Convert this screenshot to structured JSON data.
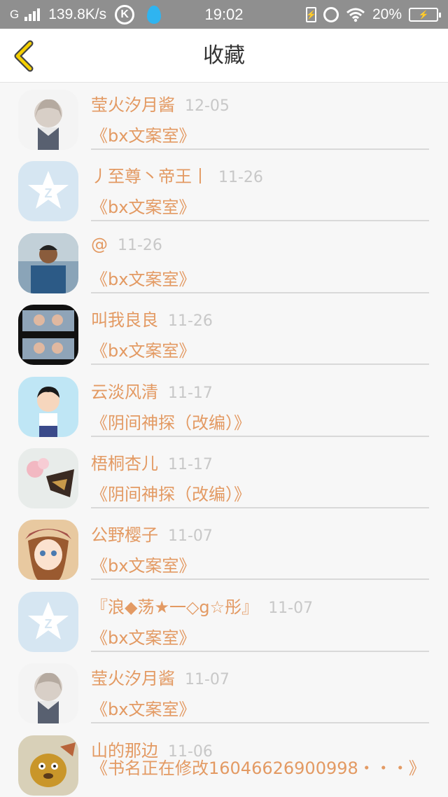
{
  "status_bar": {
    "network": "G",
    "speed": "139.8K/s",
    "k_label": "K",
    "time": "19:02",
    "battery": "20%"
  },
  "header": {
    "title": "收藏"
  },
  "favorites": [
    {
      "name": "莹火汐月酱",
      "date": "12-05",
      "title": "《bx文案室》",
      "avatar": "anime-girl-sketch"
    },
    {
      "name": "丿至尊丶帝王丨",
      "date": "11-26",
      "title": "《bx文案室》",
      "avatar": "qq-default-star"
    },
    {
      "name": "@",
      "date": "11-26",
      "title": "《bx文案室》",
      "avatar": "man-photo"
    },
    {
      "name": "叫我良良",
      "date": "11-26",
      "title": "《bx文案室》",
      "avatar": "film-strip-couple"
    },
    {
      "name": "云淡风清",
      "date": "11-17",
      "title": "《阴间神探（改编）》",
      "avatar": "cartoon-boy"
    },
    {
      "name": "梧桐杏儿",
      "date": "11-17",
      "title": "《阴间神探（改编）》",
      "avatar": "flower-painting"
    },
    {
      "name": "公野樱子",
      "date": "11-07",
      "title": "《bx文案室》",
      "avatar": "anime-girl-hat"
    },
    {
      "name": "『浪◆荡★一◇g☆彤』",
      "date": "11-07",
      "title": "《bx文案室》",
      "avatar": "qq-default-star"
    },
    {
      "name": "莹火汐月酱",
      "date": "11-07",
      "title": "《bx文案室》",
      "avatar": "anime-girl-sketch"
    },
    {
      "name": "山的那边",
      "date": "11-06",
      "title": "《书名正在修改16046626900998・・・》",
      "avatar": "cartoon-animal"
    }
  ]
}
